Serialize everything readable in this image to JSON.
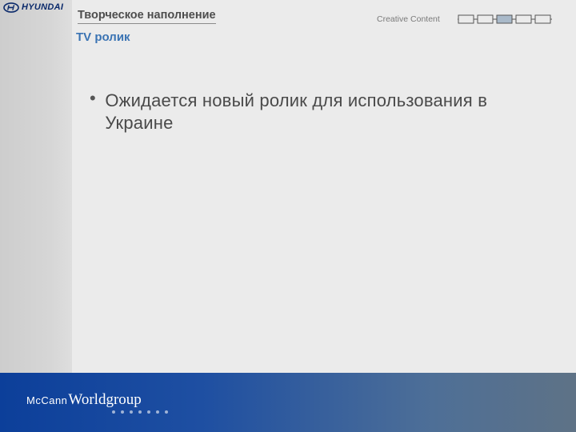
{
  "header": {
    "brand_logo_text": "HYUNDAI",
    "section_title": "Творческое наполнение",
    "subtitle": "TV ролик",
    "breadcrumb": "Creative Content",
    "nav_steps": 5,
    "active_step": 3
  },
  "content": {
    "bullets": [
      "Ожидается новый ролик для использования в Украине"
    ]
  },
  "footer": {
    "brand_part1": "McCann",
    "brand_part2": "Worldgroup",
    "dot_count": 7
  },
  "colors": {
    "title_accent": "#3a73b3",
    "footer_start": "#0c3f9a",
    "footer_end": "#5e7286"
  }
}
